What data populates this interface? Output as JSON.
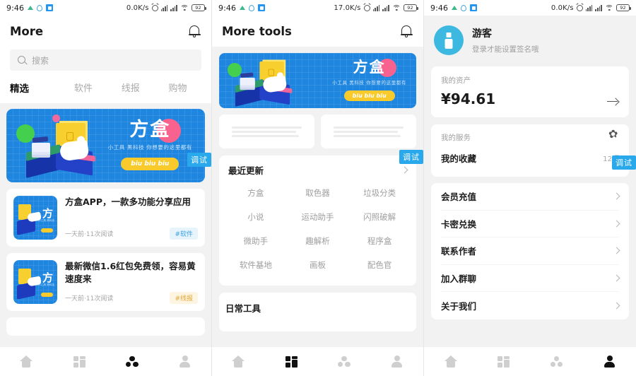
{
  "panels": [
    {
      "id": "more-feed",
      "status": {
        "time": "9:46",
        "speed": "0.0K/s",
        "battery": "92"
      },
      "header": {
        "title": "More",
        "bell_icon": "bell-icon"
      },
      "search": {
        "placeholder": "搜索",
        "icon": "search-icon"
      },
      "tabs": [
        {
          "label": "精选",
          "active": true
        },
        {
          "label": "软件",
          "active": false
        },
        {
          "label": "线报",
          "active": false
        },
        {
          "label": "购物",
          "active": false
        }
      ],
      "banner": {
        "title": "方盒",
        "subtitle": "小工具 黑科技 你想要的这里都有",
        "button": "biu biu biu"
      },
      "debug_badge": "调试",
      "articles": [
        {
          "title": "方盒APP，一款多功能分享应用",
          "meta": "一天前·11次阅读",
          "tag": "#软件",
          "tag_style": "blue"
        },
        {
          "title": "最新微信1.6红包免费领，容易黄速度来",
          "meta": "一天前·11次阅读",
          "tag": "#线报",
          "tag_style": "yellow"
        }
      ],
      "tabbar": [
        {
          "icon": "home-icon",
          "active": false
        },
        {
          "icon": "grid-icon",
          "active": false
        },
        {
          "icon": "three-circles-icon",
          "active": true
        },
        {
          "icon": "person-icon",
          "active": false
        }
      ]
    },
    {
      "id": "more-tools",
      "status": {
        "time": "9:46",
        "speed": "17.0K/s",
        "battery": "92"
      },
      "header": {
        "title": "More tools",
        "bell_icon": "bell-icon"
      },
      "banner": {
        "title": "方盒",
        "subtitle": "小工具 黑科技 你想要的这里都有",
        "button": "biu biu biu"
      },
      "debug_badge": "调试",
      "sections": [
        {
          "title": "最近更新",
          "chips": [
            "方盒",
            "取色器",
            "垃圾分类",
            "小说",
            "运动助手",
            "闪照破解",
            "微助手",
            "趣解析",
            "程序盒",
            "软件基地",
            "画板",
            "配色官"
          ]
        },
        {
          "title": "日常工具",
          "chips": []
        }
      ],
      "tabbar": [
        {
          "icon": "home-icon",
          "active": false
        },
        {
          "icon": "grid-icon",
          "active": true
        },
        {
          "icon": "three-circles-icon",
          "active": false
        },
        {
          "icon": "person-icon",
          "active": false
        }
      ]
    },
    {
      "id": "profile",
      "status": {
        "time": "9:46",
        "speed": "0.0K/s",
        "battery": "92"
      },
      "profile": {
        "name": "游客",
        "signature": "登录才能设置签名哦",
        "avatar_icon": "guest-avatar-icon"
      },
      "asset": {
        "label": "我的资产",
        "value": "¥94.61",
        "arrow_icon": "arrow-right-icon"
      },
      "service": {
        "label": "我的服务",
        "gear_icon": "gear-icon",
        "debug_badge": "调试",
        "row_label": "我的收藏",
        "row_count": "12项"
      },
      "menu": [
        {
          "label": "会员充值"
        },
        {
          "label": "卡密兑换"
        },
        {
          "label": "联系作者"
        },
        {
          "label": "加入群聊"
        },
        {
          "label": "关于我们"
        }
      ],
      "tabbar": [
        {
          "icon": "home-icon",
          "active": false
        },
        {
          "icon": "grid-icon",
          "active": false
        },
        {
          "icon": "three-circles-icon",
          "active": false
        },
        {
          "icon": "person-icon",
          "active": true
        }
      ]
    }
  ],
  "colors": {
    "accent_blue": "#1f86e0",
    "debug_badge": "#29a8ec",
    "banner_yellow": "#f7cf2e",
    "tag_blue": "#3a9fe0",
    "tag_yellow": "#e0a838",
    "avatar": "#3db8e0"
  }
}
